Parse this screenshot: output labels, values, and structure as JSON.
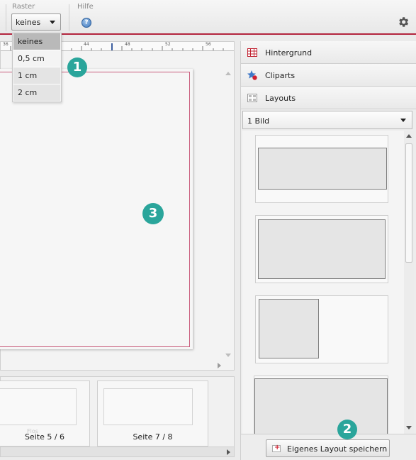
{
  "toolbar": {
    "raster_label": "Raster",
    "raster_value": "keines",
    "help_label": "Hilfe",
    "help_icon": "help-icon",
    "settings_icon": "gear-icon",
    "accent_color": "#b3243e"
  },
  "raster_dropdown": {
    "options": [
      "keines",
      "0,5 cm",
      "1 cm",
      "2 cm"
    ],
    "selected": "keines"
  },
  "ruler": {
    "ticks": [
      "36",
      "44",
      "48",
      "52",
      "56"
    ]
  },
  "canvas": {
    "page_border_color": "#c95c7c"
  },
  "thumbnails": {
    "items": [
      {
        "label": "Seite 5 / 6",
        "ghost": "Flos"
      },
      {
        "label": "Seite 7 / 8"
      }
    ]
  },
  "right_panel": {
    "sections": [
      {
        "label": "Hintergrund",
        "icon": "background-grid-icon"
      },
      {
        "label": "Cliparts",
        "icon": "clipart-icon"
      },
      {
        "label": "Layouts",
        "icon": "layouts-icon"
      }
    ],
    "layout_select_value": "1 Bild",
    "save_button_label": "Eigenes Layout speichern"
  },
  "callouts": [
    "1",
    "2",
    "3"
  ],
  "callout_color": "#2aa59b"
}
